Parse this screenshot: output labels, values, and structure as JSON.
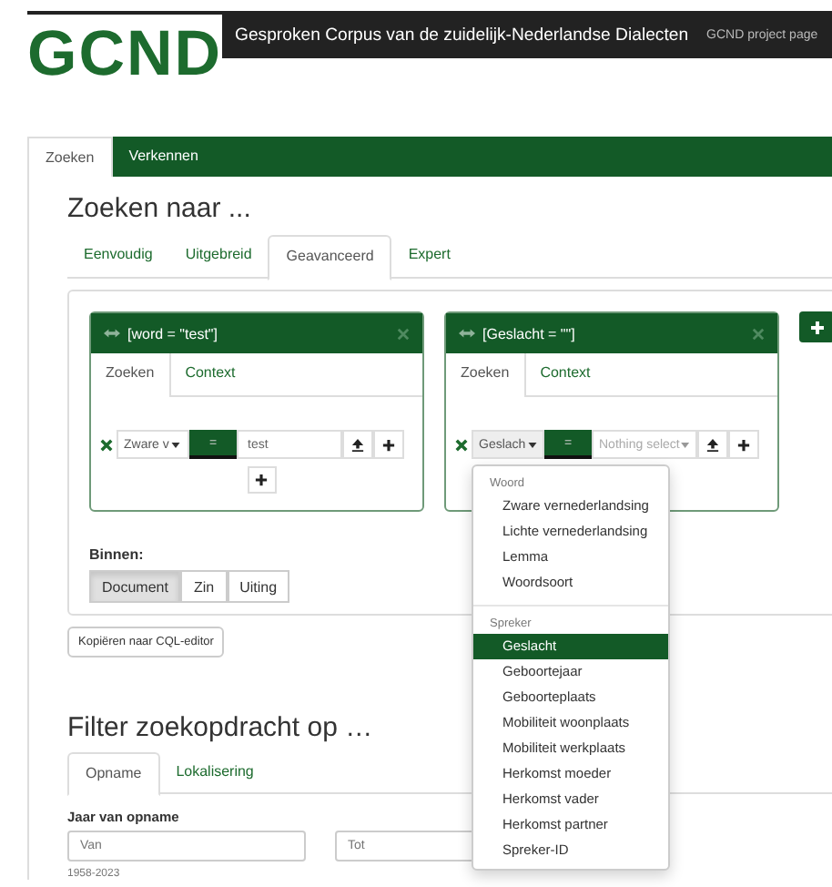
{
  "header": {
    "logo": "GCND",
    "title": "Gesproken Corpus van de zuidelijk-Nederlandse Dialecten",
    "link": "GCND project page"
  },
  "main_tabs": [
    {
      "label": "Zoeken",
      "selected": true
    },
    {
      "label": "Verkennen",
      "selected": false
    }
  ],
  "search": {
    "heading": "Zoeken naar ...",
    "tabs": [
      {
        "label": "Eenvoudig",
        "selected": false
      },
      {
        "label": "Uitgebreid",
        "selected": false
      },
      {
        "label": "Geavanceerd",
        "selected": true
      },
      {
        "label": "Expert",
        "selected": false
      }
    ],
    "queries": [
      {
        "title": "[word = \"test\"]",
        "tabs": [
          {
            "label": "Zoeken",
            "selected": true
          },
          {
            "label": "Context",
            "selected": false
          }
        ],
        "field": "Zware v",
        "operator": "=",
        "value": "test",
        "add_row": true,
        "dropdown_open": false
      },
      {
        "title": "[Geslacht = \"\"]",
        "tabs": [
          {
            "label": "Zoeken",
            "selected": true
          },
          {
            "label": "Context",
            "selected": false
          }
        ],
        "field": "Geslach",
        "operator": "=",
        "placeholder": "Nothing select",
        "add_row": false,
        "dropdown_open": true
      }
    ],
    "within_label": "Binnen:",
    "within": [
      {
        "label": "Document",
        "selected": true
      },
      {
        "label": "Zin",
        "selected": false
      },
      {
        "label": "Uiting",
        "selected": false
      }
    ],
    "copy_button": "Kopiëren naar CQL-editor"
  },
  "dropdown": {
    "groups": [
      {
        "header": "Woord",
        "items": [
          {
            "label": "Zware vernederlandsing",
            "selected": false
          },
          {
            "label": "Lichte vernederlandsing",
            "selected": false
          },
          {
            "label": "Lemma",
            "selected": false
          },
          {
            "label": "Woordsoort",
            "selected": false
          }
        ]
      },
      {
        "header": "Spreker",
        "items": [
          {
            "label": "Geslacht",
            "selected": true
          },
          {
            "label": "Geboortejaar",
            "selected": false
          },
          {
            "label": "Geboorteplaats",
            "selected": false
          },
          {
            "label": "Mobiliteit woonplaats",
            "selected": false
          },
          {
            "label": "Mobiliteit werkplaats",
            "selected": false
          },
          {
            "label": "Herkomst moeder",
            "selected": false
          },
          {
            "label": "Herkomst vader",
            "selected": false
          },
          {
            "label": "Herkomst partner",
            "selected": false
          },
          {
            "label": "Spreker-ID",
            "selected": false
          }
        ]
      }
    ]
  },
  "filter": {
    "heading": "Filter zoekopdracht op …",
    "tabs": [
      {
        "label": "Opname",
        "selected": true
      },
      {
        "label": "Lokalisering",
        "selected": false
      }
    ],
    "label": "Jaar van opname",
    "inputs": [
      {
        "placeholder": "Van"
      },
      {
        "placeholder": "Tot"
      }
    ],
    "hint": "1958-2023"
  }
}
